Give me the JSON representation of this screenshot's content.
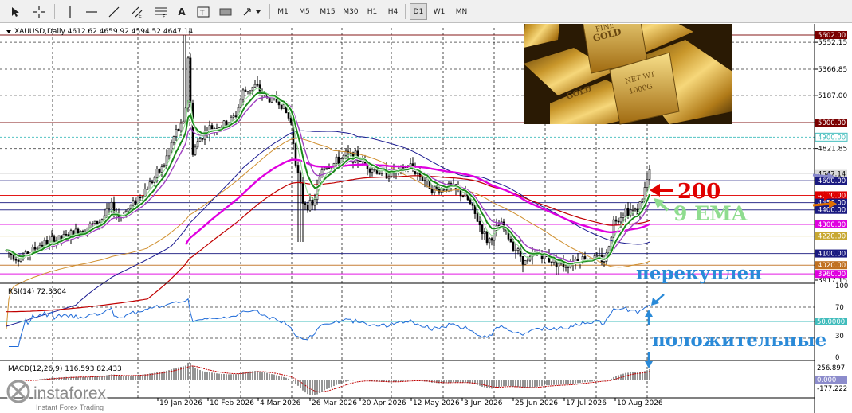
{
  "toolbar": {
    "timeframes": [
      "M1",
      "M5",
      "M15",
      "M30",
      "H1",
      "H4",
      "D1",
      "W1",
      "MN"
    ],
    "selected_timeframe": "D1",
    "text_tool_label": "A"
  },
  "chart": {
    "symbol_info": "XAUUSD,Daily  4612.62 4659.92 4594.52 4647.14",
    "price_scale": [
      "5552.15",
      "5366.85",
      "5187.00",
      "4821.85",
      "3917.15"
    ],
    "price_markers": [
      {
        "label": "5602.00",
        "value": 5602,
        "color": "#7a0000"
      },
      {
        "label": "5000.00",
        "value": 5000,
        "color": "#7a0000"
      },
      {
        "label": "4900.00",
        "value": 4900,
        "color": "#40bcbc"
      },
      {
        "label": "4647.14",
        "value": 4647.14,
        "color": "#d9d9d9"
      },
      {
        "label": "4600.00",
        "value": 4600,
        "color": "#1a1a80"
      },
      {
        "label": "4500.00",
        "value": 4500,
        "color": "#e00000"
      },
      {
        "label": "4450.00",
        "value": 4450,
        "color": "#1a1a80"
      },
      {
        "label": "4400.00",
        "value": 4400,
        "color": "#1a1a80"
      },
      {
        "label": "4300.00",
        "value": 4300,
        "color": "#e000e0"
      },
      {
        "label": "4220.00",
        "value": 4220,
        "color": "#c8a830"
      },
      {
        "label": "4100.00",
        "value": 4100,
        "color": "#1a1a80"
      },
      {
        "label": "4020.00",
        "value": 4020,
        "color": "#c07020"
      },
      {
        "label": "3960.00",
        "value": 3960,
        "color": "#e000e0"
      }
    ],
    "dates": [
      "19 Jan 2026",
      "10 Feb 2026",
      "4 Mar 2026",
      "26 Mar 2026",
      "20 Apr 2026",
      "12 May 2026",
      "3 Jun 2026",
      "25 Jun 2026",
      "17 Jul 2026",
      "10 Aug 2026"
    ],
    "annotations": {
      "ma200": "200",
      "ema9": "9 EMA",
      "overbought": "перекуплен",
      "positive": "положительные"
    },
    "rsi": {
      "label": "RSI(14) 72.3304",
      "levels": [
        "100",
        "70",
        "50.0000",
        "30",
        "0"
      ]
    },
    "macd": {
      "label": "MACD(12,26,9) 116.593 82.433",
      "levels": [
        "256.897",
        "0.000",
        "-177.222"
      ]
    },
    "watermark": {
      "brand": "instaforex",
      "tagline": "Instant Forex Trading"
    },
    "colors": {
      "ema9": "#1a8a1a",
      "fast_ma": "#a040c0",
      "ma200": "#c00000",
      "slow_ma": "#1a1a90",
      "mid_ma": "#d09030",
      "magenta_ma": "#e000e0",
      "candle": "#000000"
    }
  }
}
